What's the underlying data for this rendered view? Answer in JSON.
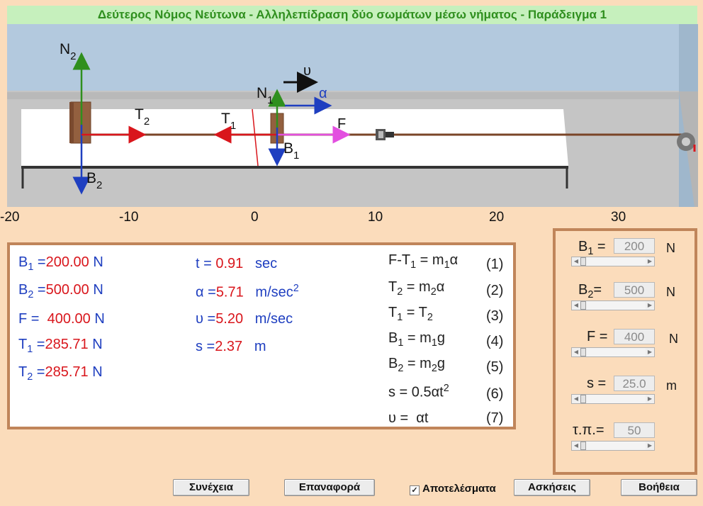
{
  "title": "Δεύτερος Νόμος Νεύτωνα  - Αλληλεπίδραση δύο σωμάτων μέσω νήματος - Παράδειγμα 1",
  "scene_labels": {
    "N2_base": "N",
    "N2_sub": "2",
    "B2_base": "B",
    "B2_sub": "2",
    "T2_base": "T",
    "T2_sub": "2",
    "T1_base": "T",
    "T1_sub": "1",
    "N1_base": "N",
    "N1_sub": "1",
    "B1_base": "B",
    "B1_sub": "1",
    "u": "υ",
    "a": "α",
    "F": "F"
  },
  "axis_ticks": [
    "-20",
    "-10",
    "0",
    "10",
    "20",
    "30"
  ],
  "results": {
    "B1": {
      "base": "B",
      "sub": "1",
      "eq": "=",
      "value": "200.00",
      "unit": "N"
    },
    "B2": {
      "base": "B",
      "sub": "2",
      "eq": "=",
      "value": "500.00",
      "unit": "N"
    },
    "F": {
      "base": "F",
      "eq": "=",
      "value": "400.00",
      "unit": "N"
    },
    "T1": {
      "base": "T",
      "sub": "1",
      "eq": "=",
      "value": "285.71",
      "unit": "N"
    },
    "T2": {
      "base": "T",
      "sub": "2",
      "eq": "=",
      "value": "285.71",
      "unit": "N"
    },
    "t": {
      "label": "t =",
      "value": "0.91",
      "unit": "sec"
    },
    "a": {
      "label": "α =",
      "value": "5.71",
      "unit": "m/sec",
      "unit_sup": "2"
    },
    "u": {
      "label": "υ =",
      "value": "5.20",
      "unit": "m/sec"
    },
    "s": {
      "label": "s =",
      "value": "2.37",
      "unit": "m"
    }
  },
  "equations": [
    {
      "num": "(1)"
    },
    {
      "num": "(2)"
    },
    {
      "num": "(3)"
    },
    {
      "num": "(4)"
    },
    {
      "num": "(5)"
    },
    {
      "num": "(6)"
    },
    {
      "num": "(7)"
    }
  ],
  "controls": {
    "B1": {
      "label_base": "B",
      "label_sub": "1",
      "eq": "=",
      "value": "200",
      "unit": "N",
      "slider_frac": 0.0
    },
    "B2": {
      "label_base": "B",
      "label_sub": "2",
      "eq": "=",
      "value": "500",
      "unit": "N",
      "slider_frac": 0.0
    },
    "F": {
      "label": "F =",
      "value": "400",
      "unit": "N",
      "slider_frac": 0.0
    },
    "s": {
      "label": "s =",
      "value": "25.0",
      "unit": "m",
      "slider_frac": 0.0
    },
    "tp": {
      "label": "τ.π.=",
      "value": "50",
      "slider_frac": 0.0
    }
  },
  "buttons": {
    "continue": "Συνέχεια",
    "reset": "Επαναφορά",
    "results_check": "Αποτελέσματα",
    "exercises": "Ασκήσεις",
    "help": "Βοήθεια"
  },
  "colors": {
    "green": "#2f8f1e",
    "red": "#d9161c",
    "blue": "#1f3fc0",
    "magenta": "#e34fe0",
    "wood": "#93603f"
  }
}
